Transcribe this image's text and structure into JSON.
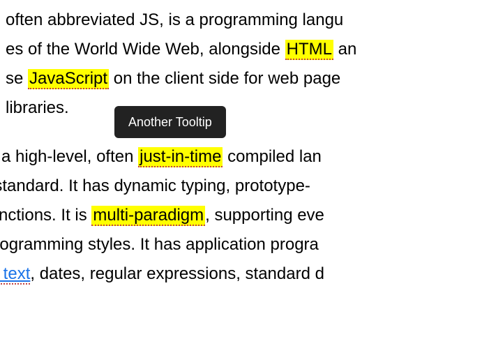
{
  "tooltip": {
    "text": "Another Tooltip"
  },
  "para1": {
    "pre1": " often abbreviated JS, is a programming langu",
    "pre2": "es of the World Wide Web, alongside ",
    "html": "HTML",
    "post2": " an",
    "pre3": "se ",
    "javascript": "JavaScript",
    "post3": " on the client side for web page",
    "line4": "libraries."
  },
  "para2": {
    "pre1": "is a high-level, often ",
    "jit": "just-in-time",
    "post1": " compiled lan",
    "line2": "t standard. It has dynamic typing, prototype-",
    "pre3": "functions. It is ",
    "multiparadigm": "multi-paradigm",
    "post3": ", supporting eve",
    "line4": "programming styles. It has application progra",
    "linktext": "th text",
    "post5": ", dates, regular expressions, standard d"
  }
}
